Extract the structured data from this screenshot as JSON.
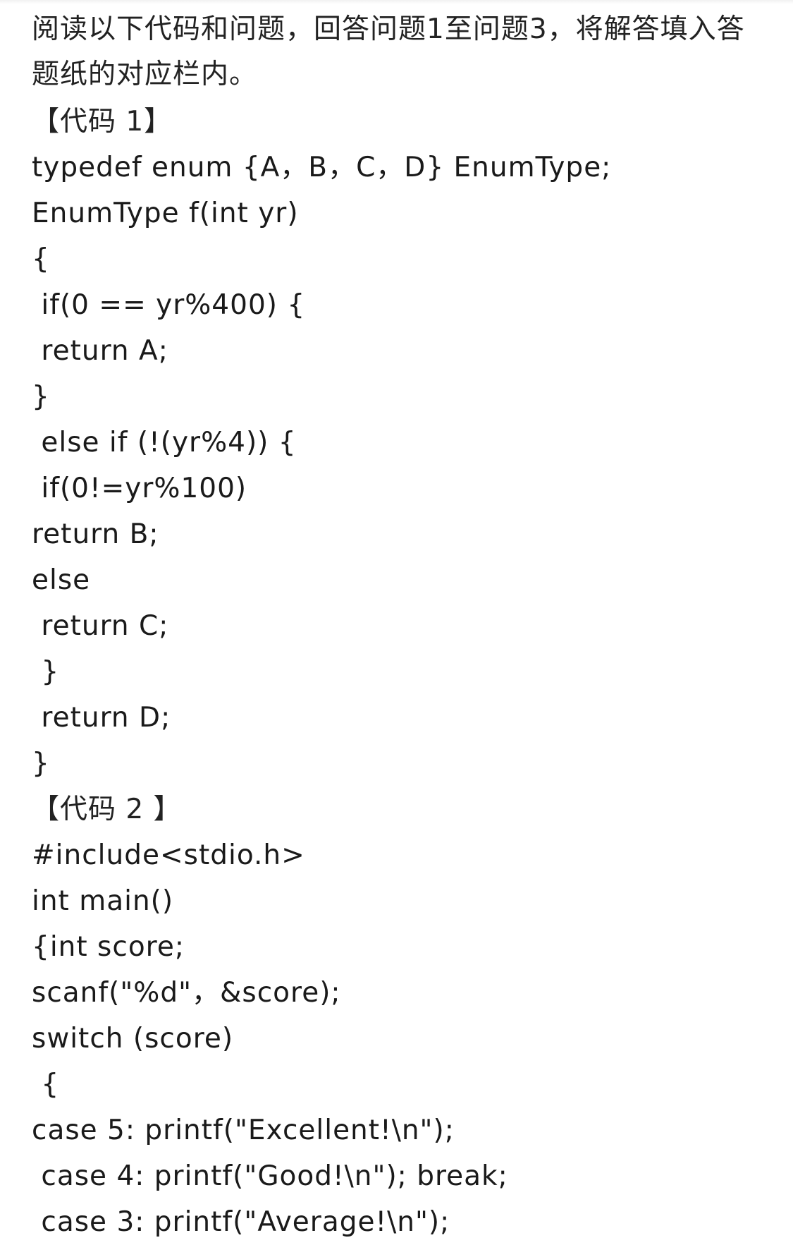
{
  "question": {
    "intro": "阅读以下代码和问题，回答问题1至问题3，将解答填入答题纸的对应栏内。",
    "lines": [
      "【代码 1】",
      "typedef enum {A，B，C，D} EnumType;",
      "EnumType f(int yr)",
      "{",
      " if(0 == yr%400) {",
      " return A;",
      "}",
      " else if (!(yr%4)) {",
      " if(0!=yr%100)",
      "return B;",
      "else",
      " return C;",
      " }",
      " return D;",
      "}",
      "【代码 2 】",
      "#include<stdio.h>",
      "int main()",
      "{int score;",
      "scanf(\"%d\"，&score);",
      "switch (score)",
      " {",
      "case 5: printf(\"Excellent!\\n\");",
      " case 4: printf(\"Good!\\n\"); break;",
      " case 3: printf(\"Average!\\n\");"
    ]
  }
}
